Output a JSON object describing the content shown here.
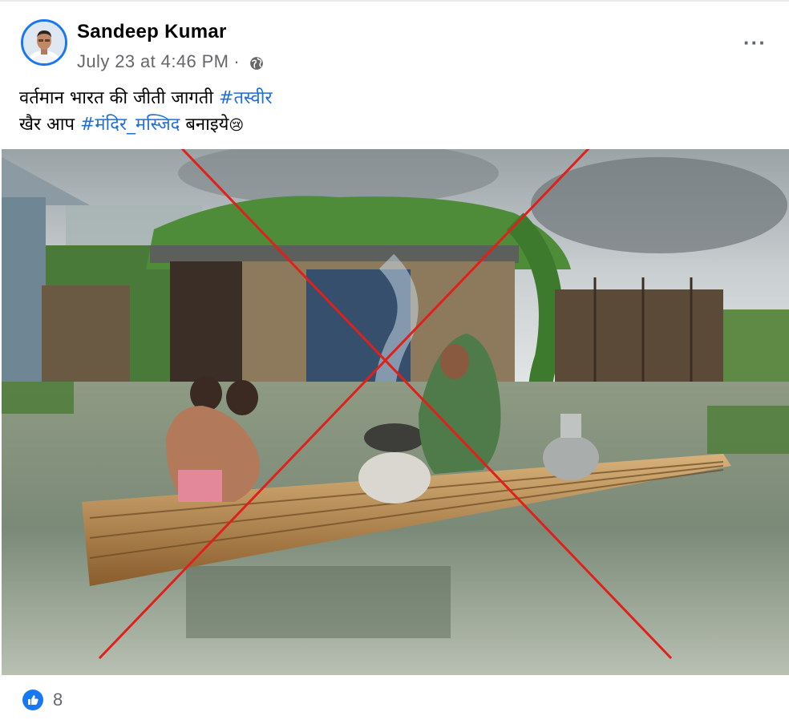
{
  "post": {
    "author": "Sandeep Kumar",
    "timestamp": "July 23 at 4:46 PM",
    "separator": "·",
    "privacy_icon": "globe-icon",
    "more_label": "···",
    "line1_text": "वर्तमान भारत की जीती जागती ",
    "line1_hashtag": "#तस्वीर",
    "line2_text": "खैर आप ",
    "line2_hashtag": "#मंदिर_मस्जिद",
    "line2_after": " बनाइये",
    "emoji": "😢"
  },
  "reactions": {
    "icon": "like-icon",
    "count": "8"
  },
  "colors": {
    "accent": "#1877f2",
    "hashtag": "#216fdb",
    "cross": "#e0201a"
  }
}
